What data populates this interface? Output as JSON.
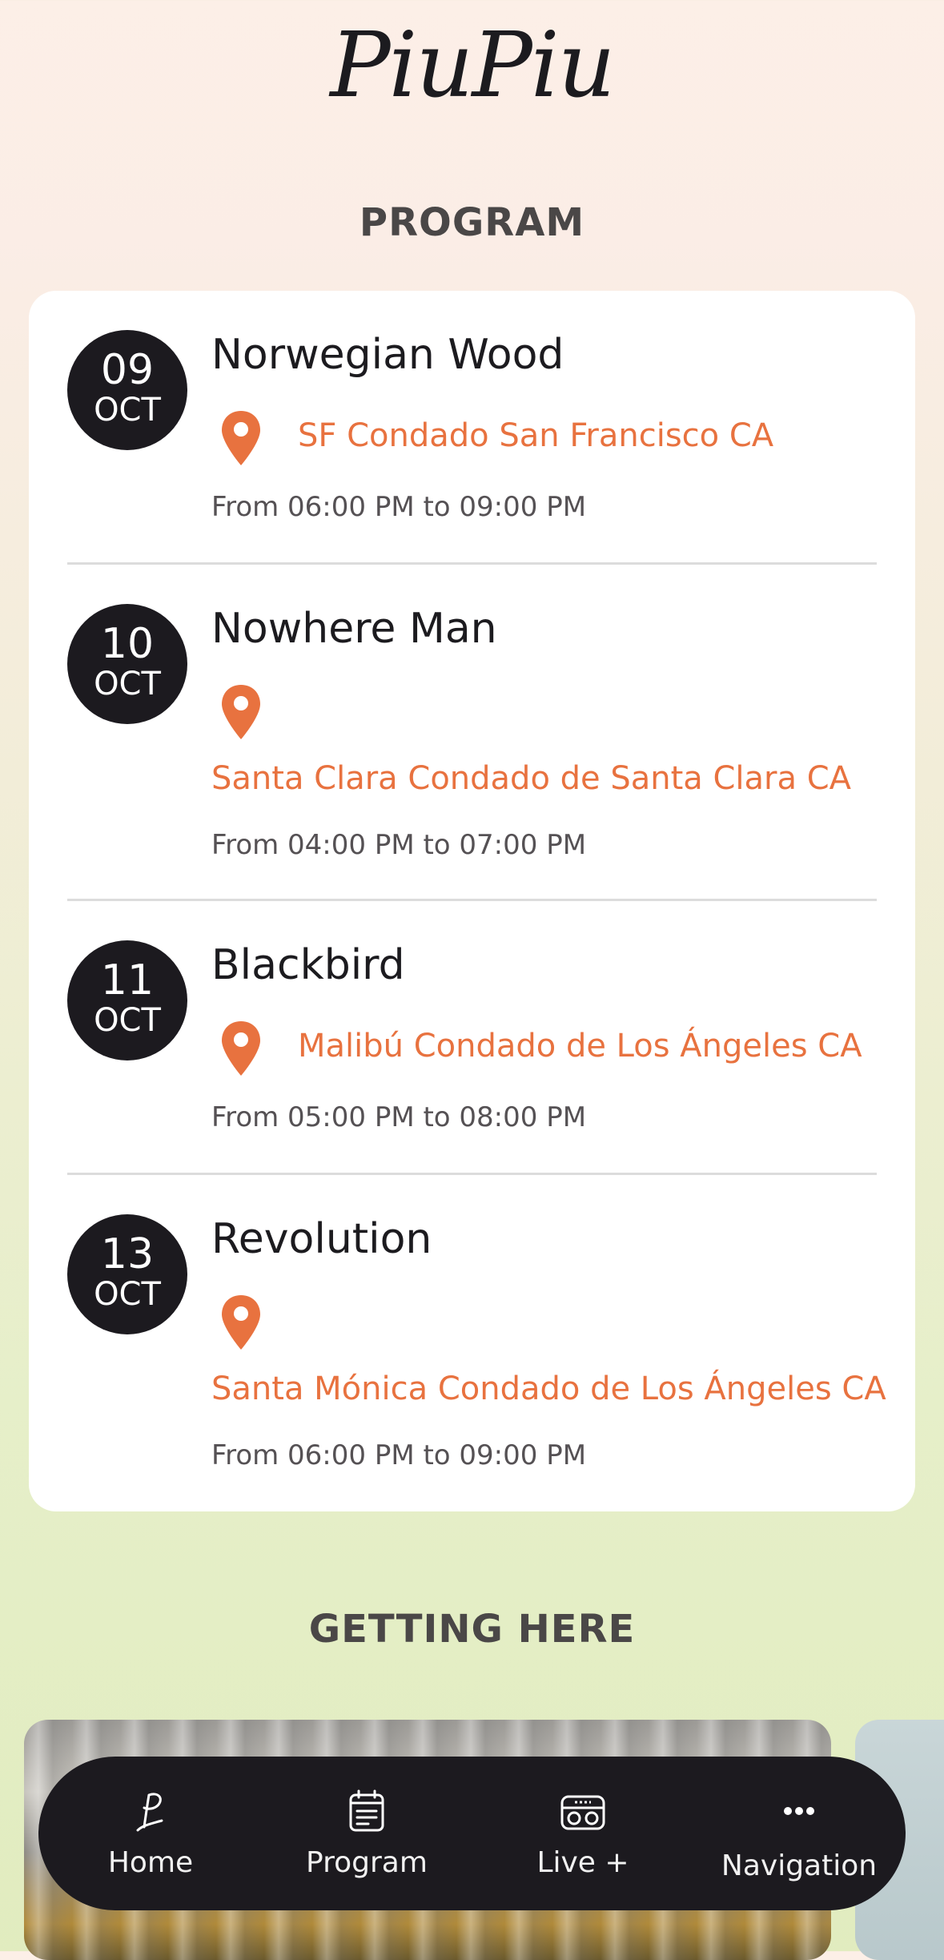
{
  "header": {
    "logo_text": "PiuPiu"
  },
  "program": {
    "title": "PROGRAM",
    "events": [
      {
        "day": "09",
        "month": "OCT",
        "title": "Norwegian Wood",
        "location": "SF Condado San Francisco CA",
        "time": "From 06:00 PM to 09:00 PM"
      },
      {
        "day": "10",
        "month": "OCT",
        "title": "Nowhere Man",
        "location": "Santa Clara Condado de Santa Clara CA",
        "time": "From 04:00 PM to 07:00 PM"
      },
      {
        "day": "11",
        "month": "OCT",
        "title": "Blackbird",
        "location": "Malibú Condado de Los Ángeles CA",
        "time": "From 05:00 PM to 08:00 PM"
      },
      {
        "day": "13",
        "month": "OCT",
        "title": "Revolution",
        "location": "Santa Mónica Condado de Los Ángeles CA",
        "time": "From 06:00 PM to 09:00 PM"
      }
    ]
  },
  "getting_here": {
    "title": "GETTING HERE"
  },
  "navbar": {
    "items": [
      {
        "label": "Home",
        "icon": "piupiu-logo-icon"
      },
      {
        "label": "Program",
        "icon": "calendar-list-icon"
      },
      {
        "label": "Live +",
        "icon": "radio-icon"
      },
      {
        "label": "Navigation",
        "icon": "more-dots-icon"
      }
    ]
  },
  "colors": {
    "accent": "#e8723f",
    "dark": "#1c1a1f",
    "card": "#ffffff"
  }
}
